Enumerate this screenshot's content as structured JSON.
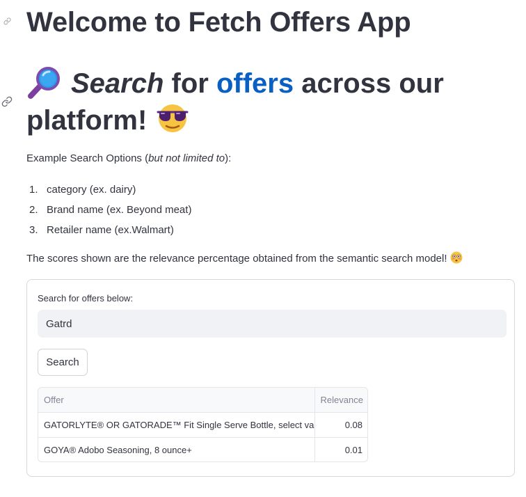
{
  "app": {
    "title": "Welcome to Fetch Offers App"
  },
  "heading": {
    "emoji_left": "magnifier-icon",
    "part1_italic": "Search",
    "part2": " for ",
    "part3_link": "offers",
    "part4": " across our platform!",
    "emoji_right": "sunglasses-face-icon",
    "link_color": "#0a60c2"
  },
  "intro": {
    "prefix": "Example Search Options (",
    "italic": "but not limited to",
    "suffix": "):"
  },
  "options": [
    {
      "num": "1.",
      "text": "category (ex. dairy)"
    },
    {
      "num": "2.",
      "text": "Brand name (ex. Beyond meat)"
    },
    {
      "num": "3.",
      "text": "Retailer name (ex.Walmart)"
    }
  ],
  "scores_note": {
    "text": "The scores shown are the relevance percentage obtained from the semantic search model!",
    "emoji": "flushed-face-icon"
  },
  "search_form": {
    "label": "Search for offers below:",
    "value": "Gatrd",
    "button_label": "Search"
  },
  "results": {
    "columns": [
      "Offer",
      "Relevance"
    ],
    "rows": [
      {
        "offer": "GATORLYTE® OR GATORADE™ Fit Single Serve Bottle, select varieties",
        "relevance": "0.08"
      },
      {
        "offer": "GOYA® Adobo Seasoning, 8 ounce+",
        "relevance": "0.01"
      }
    ]
  },
  "colors": {
    "text": "#31333f",
    "input_bg": "#f0f2f6",
    "border": "#d6d7db"
  }
}
